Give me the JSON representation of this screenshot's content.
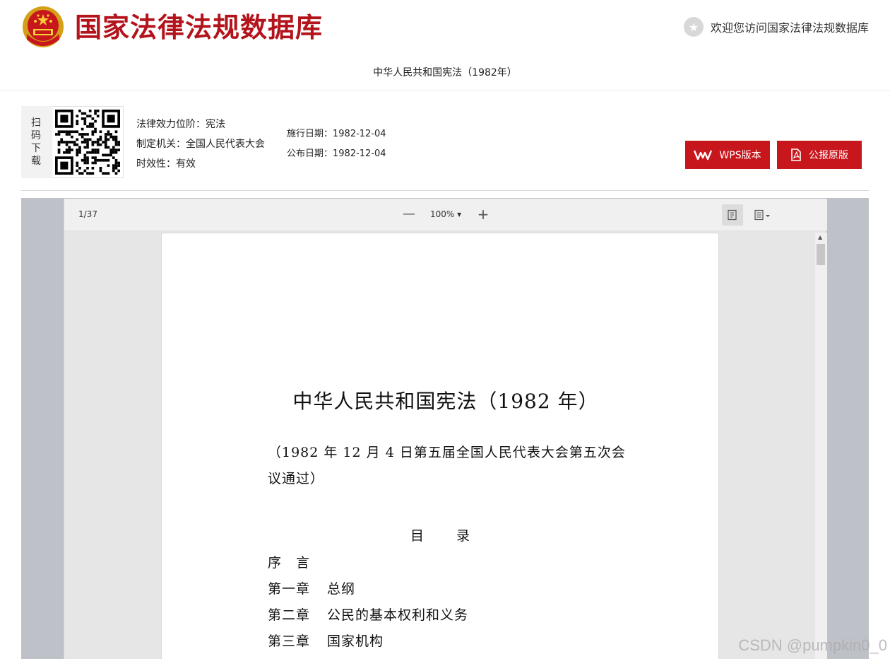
{
  "header": {
    "site_title": "国家法律法规数据库",
    "welcome": "欢迎您访问国家法律法规数据库",
    "law_name": "中华人民共和国宪法（1982年）"
  },
  "info": {
    "scan_label": [
      "扫",
      "码",
      "下",
      "载"
    ],
    "meta_left": [
      "法律效力位阶：宪法",
      "制定机关：全国人民代表大会",
      "时效性：有效"
    ],
    "meta_right": [
      "施行日期：1982-12-04",
      "公布日期：1982-12-04"
    ],
    "buttons": {
      "wps": "WPS版本",
      "pdf": "公报原版"
    }
  },
  "viewer": {
    "page_count": "1/37",
    "zoom_out": "—",
    "zoom": "100%",
    "zoom_in": "+"
  },
  "document": {
    "title": "中华人民共和国宪法（1982 年）",
    "subtitle": "（1982 年 12 月 4 日第五届全国人民代表大会第五次会议通过）",
    "toc_head": "目 录",
    "toc": [
      {
        "chapter": "序　言",
        "name": ""
      },
      {
        "chapter": "第一章",
        "name": "总纲"
      },
      {
        "chapter": "第二章",
        "name": "公民的基本权利和义务"
      },
      {
        "chapter": "第三章",
        "name": "国家机构"
      }
    ]
  },
  "watermark": "CSDN @pumpkin0_0",
  "colors": {
    "brand_red": "#c8161d",
    "title_red": "#b3141b"
  },
  "icons": [
    "national-emblem-icon",
    "star-icon",
    "qr-code",
    "wps-icon",
    "pdf-icon",
    "page-view-icon",
    "layout-menu-icon"
  ]
}
